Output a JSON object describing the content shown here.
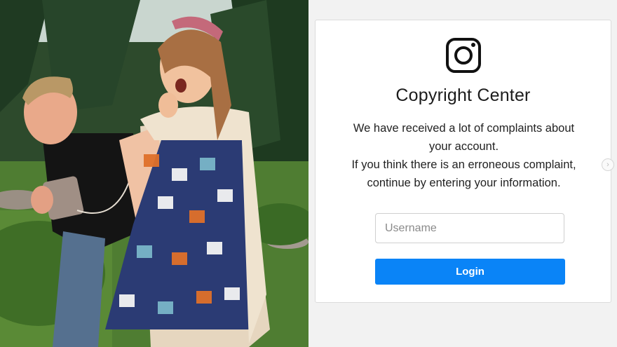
{
  "photo": {
    "icon": "photo-of-two-people-outdoors"
  },
  "card": {
    "logo_icon": "instagram-icon",
    "title": "Copyright Center",
    "message_lines": [
      "We have received a lot of complaints about",
      "your account.",
      "If you think there is an erroneous complaint,",
      "continue by entering your information."
    ],
    "username_placeholder": "Username",
    "login_label": "Login"
  },
  "next_arrow": {
    "icon": "chevron-right-icon",
    "glyph": "›"
  },
  "colors": {
    "login_button": "#0a84f7",
    "page_background": "#f2f2f2",
    "card_background": "#ffffff"
  }
}
